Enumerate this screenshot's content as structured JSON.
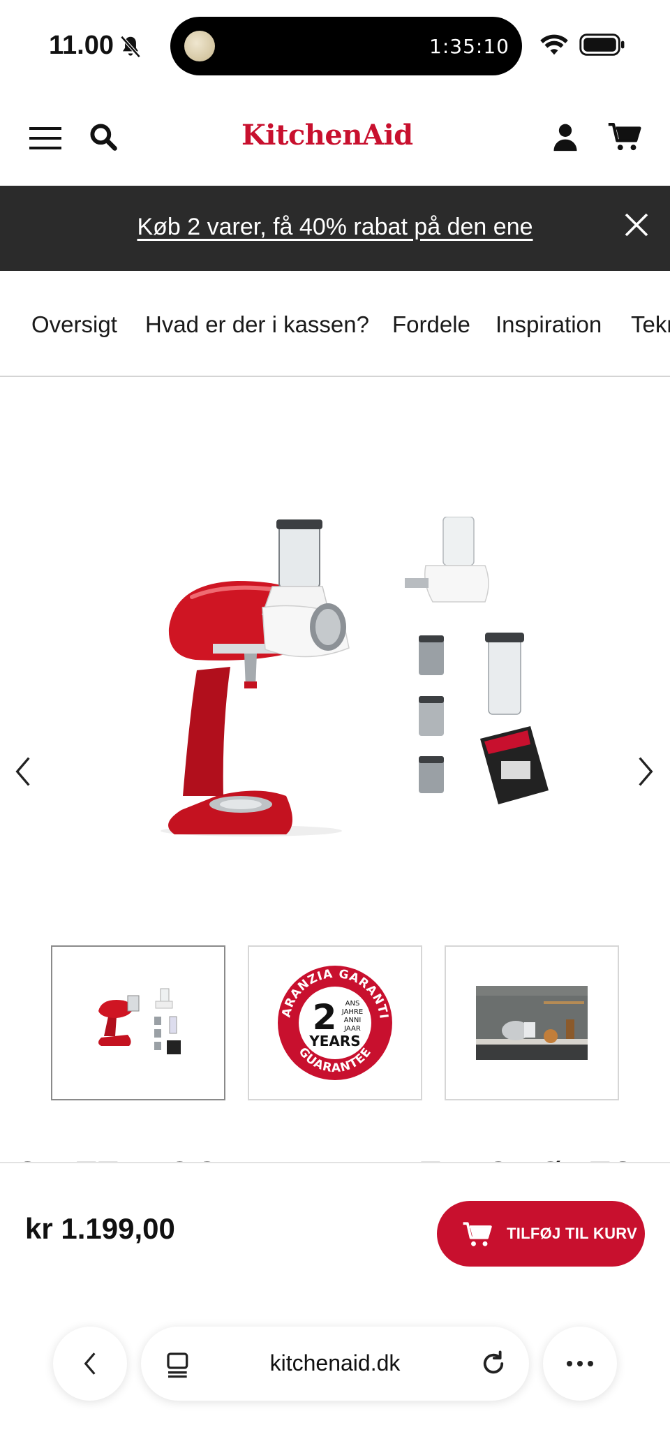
{
  "status_bar": {
    "time": "11.00",
    "timer": "1:35:10",
    "icons": [
      "bell-slash-icon",
      "wifi-icon",
      "battery-icon"
    ]
  },
  "header": {
    "logo": "KitchenAid",
    "brand_color": "#c8102e",
    "icons": [
      "menu-icon",
      "search-icon",
      "account-icon",
      "cart-icon"
    ]
  },
  "promo": {
    "text": "Køb 2 varer, få 40% rabat på den ene",
    "background": "#2b2b2b"
  },
  "tabs": [
    {
      "label": "Oversigt"
    },
    {
      "label": "Hvad er der i kassen?"
    },
    {
      "label": "Fordele"
    },
    {
      "label": "Inspiration"
    },
    {
      "label": "Tekn"
    }
  ],
  "badge": {
    "ring_top": "GARANZIA GARANTIE",
    "number": "2",
    "side": [
      "ANS",
      "JAHRE",
      "ANNI",
      "JAAR"
    ],
    "years": "YEARS",
    "ring_bottom": "GUARANTEE"
  },
  "product": {
    "title_peek": "SNITTE- OG RIVEJERN TIL GRØNTSAGER",
    "price": "kr 1.199,00",
    "add_to_cart": "TILFØJ TIL KURV"
  },
  "browser": {
    "url": "kitchenaid.dk"
  }
}
